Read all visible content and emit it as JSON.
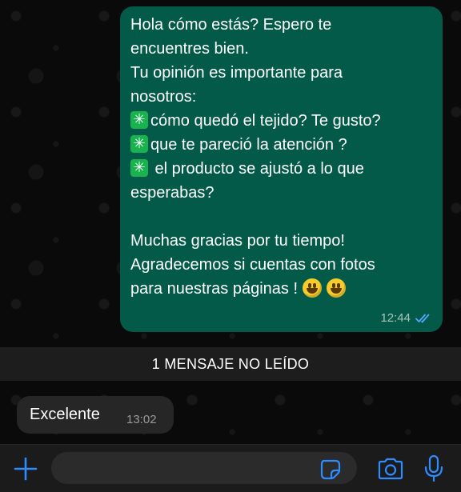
{
  "outgoing_message": {
    "lines": [
      {
        "text": "Hola cómo estás?  Espero te"
      },
      {
        "text": "encuentres bien."
      },
      {
        "text": "Tu opinión es importante para"
      },
      {
        "text": "nosotros:"
      },
      {
        "icon": "sparkle-emoji",
        "text": "cómo quedó el tejido? Te gusto?"
      },
      {
        "icon": "sparkle-emoji",
        "text": "que te pareció la atención ?"
      },
      {
        "icon": "sparkle-emoji",
        "text": " el producto se ajustó a lo que"
      },
      {
        "text": "esperabas?"
      },
      {
        "text": ""
      },
      {
        "text": "Muchas gracias por tu tiempo!"
      },
      {
        "text": "Agradecemos si cuentas con fotos"
      },
      {
        "text": "para nuestras páginas !",
        "trailing_icons": [
          "smiley-emoji",
          "smiley-emoji"
        ]
      }
    ],
    "time": "12:44",
    "status_icon": "double-check-read-icon",
    "color": "#035a49"
  },
  "unread_banner": "1 MENSAJE NO LEÍDO",
  "incoming_message": {
    "text": "Excelente",
    "time": "13:02",
    "color": "#262626"
  },
  "composer": {
    "placeholder": "",
    "icons": [
      "plus-icon",
      "sticker-icon",
      "camera-icon",
      "microphone-icon"
    ],
    "accent": "#2f8cff"
  }
}
